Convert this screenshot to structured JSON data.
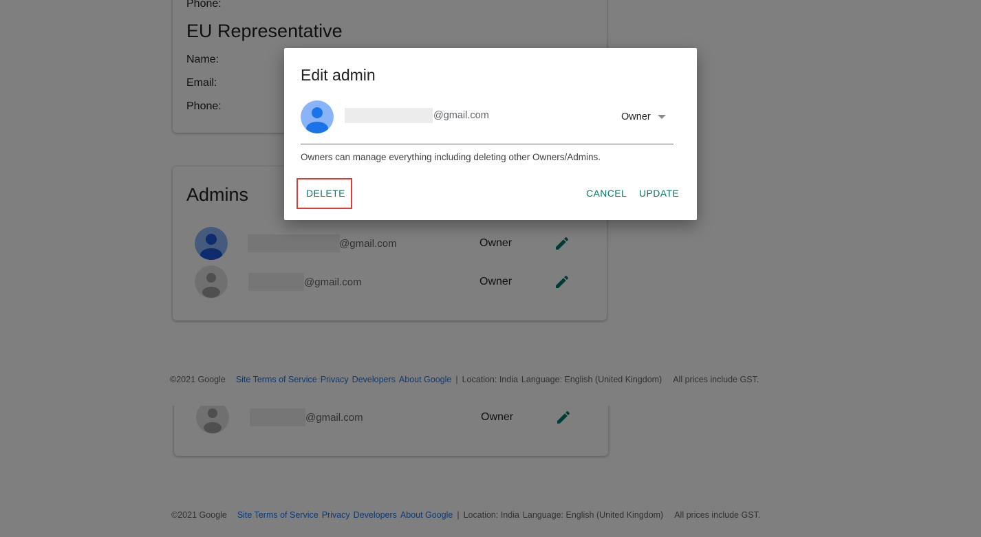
{
  "contact": {
    "phone_label": "Phone:",
    "eu_title": "EU Representative",
    "name_label": "Name:",
    "email_label": "Email:",
    "phone_label_2": "Phone:"
  },
  "admins": {
    "title": "Admins",
    "rows": [
      {
        "email_suffix": "@gmail.com",
        "role": "Owner",
        "avatar": "blue-person-avatar"
      },
      {
        "email_suffix": "@gmail.com",
        "role": "Owner",
        "avatar": "grey-person-avatar"
      }
    ],
    "duplicate_row": {
      "email_suffix": "@gmail.com",
      "role": "Owner",
      "avatar": "grey-person-avatar"
    }
  },
  "footer": {
    "copyright": "©2021 Google",
    "links": [
      "Site Terms of Service",
      "Privacy",
      "Developers",
      "About Google"
    ],
    "separator": "|",
    "location": "Location: India",
    "language": "Language: English (United Kingdom)",
    "prices": "All prices include GST."
  },
  "dialog": {
    "title": "Edit admin",
    "email_suffix": "@gmail.com",
    "role_selected": "Owner",
    "helper_text": "Owners can manage everything including deleting other Owners/Admins.",
    "delete_label": "DELETE",
    "cancel_label": "CANCEL",
    "update_label": "UPDATE"
  },
  "colors": {
    "accent": "#00796b",
    "link": "#1a73e8",
    "highlight": "#e53935",
    "avatar_blue": "#8ab4f8"
  },
  "icons": {
    "edit": "pencil-icon",
    "dropdown": "caret-down-icon",
    "avatar": "person-icon"
  }
}
